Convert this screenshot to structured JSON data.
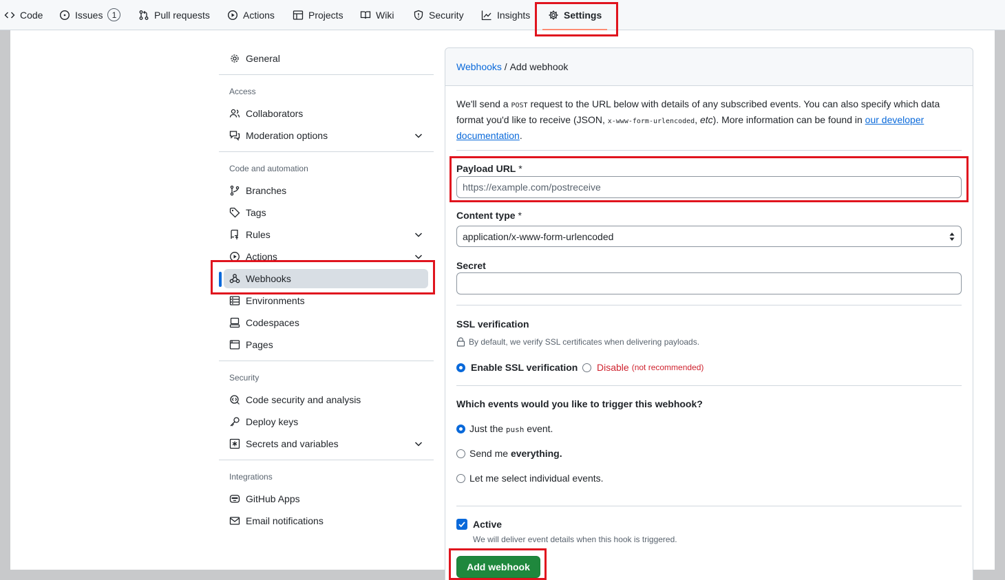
{
  "nav": {
    "tabs": [
      {
        "label": "Code",
        "icon": "code-icon"
      },
      {
        "label": "Issues",
        "icon": "issue-opened-icon",
        "count": "1"
      },
      {
        "label": "Pull requests",
        "icon": "git-pull-request-icon"
      },
      {
        "label": "Actions",
        "icon": "play-icon"
      },
      {
        "label": "Projects",
        "icon": "table-icon"
      },
      {
        "label": "Wiki",
        "icon": "book-icon"
      },
      {
        "label": "Security",
        "icon": "shield-icon"
      },
      {
        "label": "Insights",
        "icon": "graph-icon"
      },
      {
        "label": "Settings",
        "icon": "gear-icon",
        "selected": true
      }
    ]
  },
  "sidebar": {
    "general": "General",
    "sections": [
      {
        "heading": "Access",
        "items": [
          "Collaborators",
          "Moderation options"
        ]
      },
      {
        "heading": "Code and automation",
        "items": [
          "Branches",
          "Tags",
          "Rules",
          "Actions",
          "Webhooks",
          "Environments",
          "Codespaces",
          "Pages"
        ]
      },
      {
        "heading": "Security",
        "items": [
          "Code security and analysis",
          "Deploy keys",
          "Secrets and variables"
        ]
      },
      {
        "heading": "Integrations",
        "items": [
          "GitHub Apps",
          "Email notifications"
        ]
      }
    ],
    "active_item": "Webhooks"
  },
  "main": {
    "breadcrumb_link": "Webhooks",
    "breadcrumb_sep": " / ",
    "breadcrumb_current": "Add webhook",
    "intro_1": "We'll send a ",
    "intro_code_post": "POST",
    "intro_2": " request to the URL below with details of any subscribed events. You can also specify which data format you'd like to receive (JSON, ",
    "intro_code_form": "x-www-form-urlencoded",
    "intro_3": ", ",
    "intro_etc": "etc",
    "intro_4": "). More information can be found in ",
    "intro_link": "our developer documentation",
    "intro_5": ".",
    "payload_label": "Payload URL",
    "required_mark": " *",
    "payload_placeholder": "https://example.com/postreceive",
    "content_type_label": "Content type",
    "content_type_value": "application/x-www-form-urlencoded",
    "secret_label": "Secret",
    "secret_value": "",
    "ssl_heading": "SSL verification",
    "ssl_note": "By default, we verify SSL certificates when delivering payloads.",
    "ssl_enable": "Enable SSL verification",
    "ssl_disable": "Disable",
    "ssl_disable_note": "(not recommended)",
    "events_heading": "Which events would you like to trigger this webhook?",
    "event_push_1": "Just the ",
    "event_push_code": "push",
    "event_push_2": " event.",
    "event_all_1": "Send me ",
    "event_all_2": "everything.",
    "event_select": "Let me select individual events.",
    "active_label": "Active",
    "active_note": "We will deliver event details when this hook is triggered.",
    "submit_label": "Add webhook"
  },
  "colors": {
    "accent": "#0969da",
    "primary_button": "#1f883d",
    "annotation_red": "#e0141e"
  }
}
